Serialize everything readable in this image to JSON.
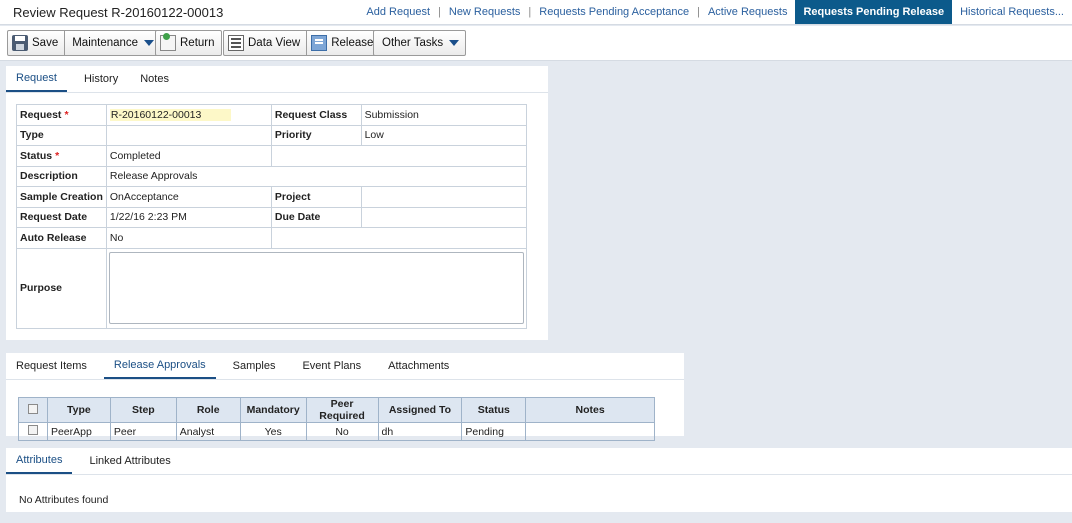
{
  "header": {
    "title": "Review Request R-20160122-00013",
    "nav": [
      {
        "label": "Add Request",
        "active": false
      },
      {
        "label": "New Requests",
        "active": false
      },
      {
        "label": "Requests Pending Acceptance",
        "active": false
      },
      {
        "label": "Active Requests",
        "active": false
      },
      {
        "label": "Requests Pending Release",
        "active": true
      },
      {
        "label": "Historical Requests..."
      }
    ]
  },
  "toolbar": {
    "save": "Save",
    "maintenance": "Maintenance",
    "return": "Return",
    "data_view": "Data View",
    "release": "Release",
    "other_tasks": "Other Tasks"
  },
  "top_tabs": [
    "Request",
    "History",
    "Notes"
  ],
  "form": {
    "request_label": "Request",
    "request_value": "R-20160122-00013",
    "request_class_label": "Request Class",
    "request_class_value": "Submission",
    "type_label": "Type",
    "type_value": "",
    "priority_label": "Priority",
    "priority_value": "Low",
    "status_label": "Status",
    "status_value": "Completed",
    "description_label": "Description",
    "description_value": "Release Approvals",
    "sample_creation_label": "Sample Creation",
    "sample_creation_value": "OnAcceptance",
    "project_label": "Project",
    "project_value": "",
    "request_date_label": "Request Date",
    "request_date_value": "1/22/16 2:23 PM",
    "due_date_label": "Due Date",
    "due_date_value": "",
    "auto_release_label": "Auto Release",
    "auto_release_value": "No",
    "purpose_label": "Purpose",
    "purpose_value": "",
    "required_mark": "*"
  },
  "mid_tabs": [
    "Request Items",
    "Release Approvals",
    "Samples",
    "Event Plans",
    "Attachments"
  ],
  "grid": {
    "headers": [
      "Type",
      "Step",
      "Role",
      "Mandatory",
      "Peer Required",
      "Assigned To",
      "Status",
      "Notes"
    ],
    "rows": [
      {
        "type": "PeerApp",
        "step": "Peer",
        "role": "Analyst",
        "mandatory": "Yes",
        "peer_required": "No",
        "assigned_to": "dh",
        "status": "Pending",
        "notes": ""
      }
    ]
  },
  "bottom_tabs": [
    "Attributes",
    "Linked Attributes"
  ],
  "attributes_empty": "No Attributes found"
}
